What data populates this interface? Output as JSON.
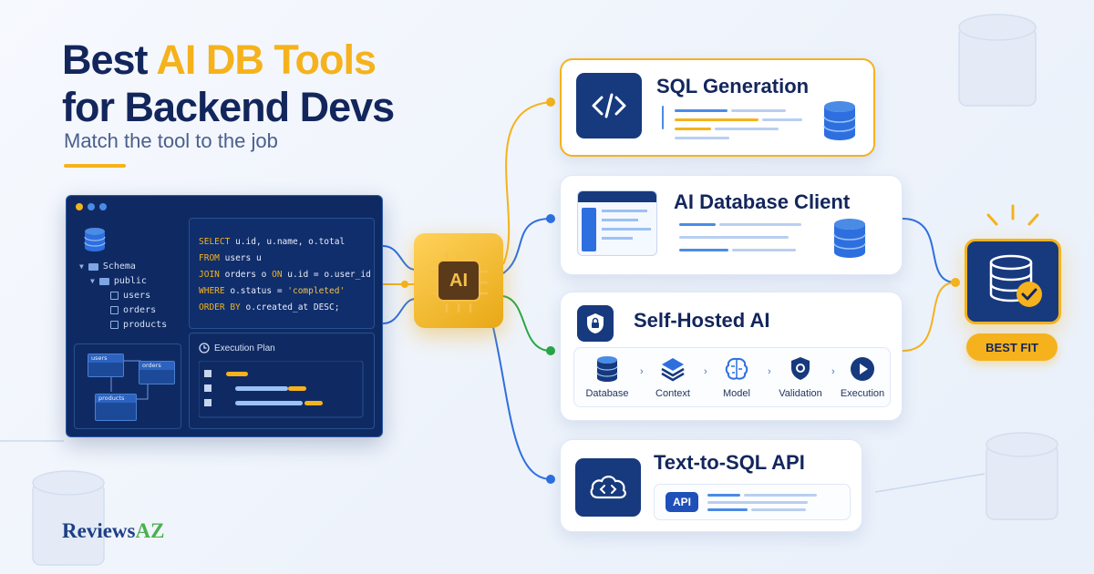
{
  "headline": {
    "line1_prefix": "Best ",
    "line1_highlight": "AI DB Tools",
    "line2": "for Backend Devs",
    "subtitle": "Match the tool to the job"
  },
  "editor": {
    "schema": {
      "label": "Schema",
      "folder": "public",
      "tables": [
        "users",
        "orders",
        "products"
      ]
    },
    "sql": [
      {
        "kw": "SELECT",
        "rest": "u.id, u.name, o.total"
      },
      {
        "kw": "FROM",
        "rest": "users u"
      },
      {
        "kw": "JOIN",
        "rest": "orders o ",
        "kw2": "ON",
        "rest2": " u.id = o.user_id"
      },
      {
        "kw": "WHERE",
        "rest": "o.status = ",
        "str": "'completed'"
      },
      {
        "kw": "ORDER BY",
        "rest": "o.created_at DESC;"
      }
    ],
    "erd": {
      "tables": [
        "users",
        "orders",
        "products"
      ]
    },
    "plan_title": "Execution Plan"
  },
  "chip": {
    "label": "AI"
  },
  "cards": {
    "sql_generation": {
      "title": "SQL Generation"
    },
    "ai_client": {
      "title": "AI Database Client"
    },
    "self_hosted": {
      "title": "Self-Hosted AI",
      "steps": [
        "Database",
        "Context",
        "Model",
        "Validation",
        "Execution"
      ]
    },
    "text_to_sql": {
      "title": "Text-to-SQL API",
      "badge": "API"
    }
  },
  "best_fit": {
    "label": "BEST FIT"
  },
  "brand": {
    "name": "Reviews",
    "suffix": "AZ"
  },
  "colors": {
    "navy": "#13265c",
    "gold": "#f5b21c",
    "blue": "#2e6fe0",
    "green": "#27a745"
  }
}
